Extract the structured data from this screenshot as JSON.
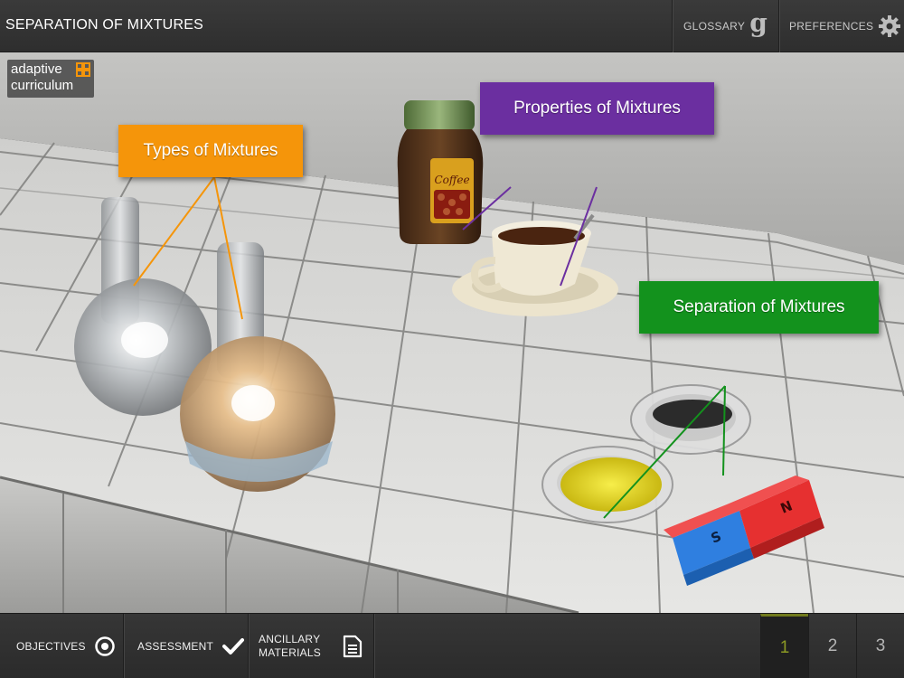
{
  "header": {
    "title": "SEPARATION OF MIXTURES",
    "glossary_label": "GLOSSARY",
    "glossary_icon": "g",
    "preferences_label": "PREFERENCES"
  },
  "logo": {
    "line1": "adaptive",
    "line2": "curriculum"
  },
  "callouts": {
    "types": {
      "label": "Types of Mixtures",
      "color": "#f5950a"
    },
    "properties": {
      "label": "Properties of Mixtures",
      "color": "#6b2fa0"
    },
    "separation": {
      "label": "Separation of Mixtures",
      "color": "#13921d"
    }
  },
  "magnet": {
    "north": "N",
    "south": "S"
  },
  "jar_label": "Coffee",
  "footer": {
    "objectives_label": "OBJECTIVES",
    "assessment_label": "ASSESSMENT",
    "ancillary_line1": "ANCILLARY",
    "ancillary_line2": "MATERIALS",
    "pages": [
      "1",
      "2",
      "3"
    ],
    "current_page": "1",
    "active_color": "#8c9a24"
  }
}
